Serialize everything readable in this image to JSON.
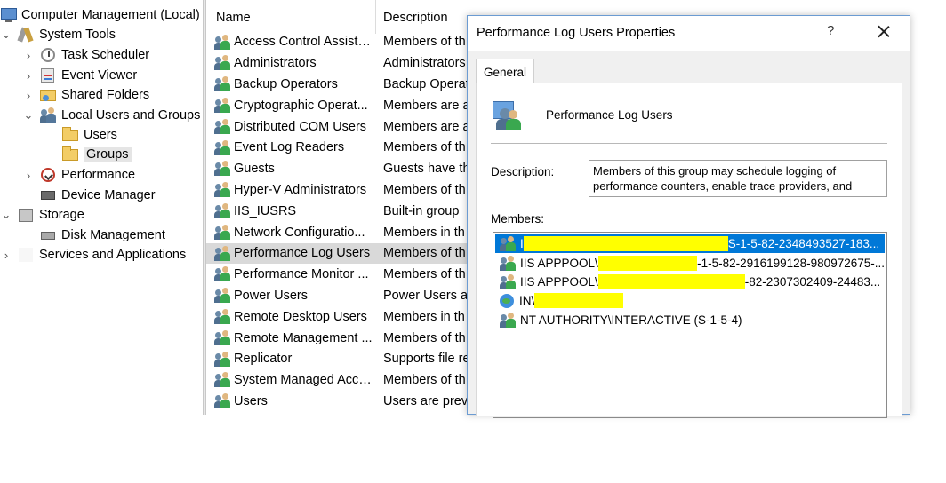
{
  "tree": {
    "items": [
      {
        "label": "Computer Management (Local)"
      },
      {
        "label": "System Tools"
      },
      {
        "label": "Task Scheduler"
      },
      {
        "label": "Event Viewer"
      },
      {
        "label": "Shared Folders"
      },
      {
        "label": "Local Users and Groups"
      },
      {
        "label": "Users"
      },
      {
        "label": "Groups"
      },
      {
        "label": "Performance"
      },
      {
        "label": "Device Manager"
      },
      {
        "label": "Storage"
      },
      {
        "label": "Disk Management"
      },
      {
        "label": "Services and Applications"
      }
    ]
  },
  "list": {
    "columns": [
      "Name",
      "Description"
    ],
    "rows": [
      {
        "name": "Access Control Assista...",
        "desc": "Members of th"
      },
      {
        "name": "Administrators",
        "desc": "Administrators"
      },
      {
        "name": "Backup Operators",
        "desc": "Backup Operat"
      },
      {
        "name": "Cryptographic Operat...",
        "desc": "Members are a"
      },
      {
        "name": "Distributed COM Users",
        "desc": "Members are a"
      },
      {
        "name": "Event Log Readers",
        "desc": "Members of th"
      },
      {
        "name": "Guests",
        "desc": "Guests have th"
      },
      {
        "name": "Hyper-V Administrators",
        "desc": "Members of th"
      },
      {
        "name": "IIS_IUSRS",
        "desc": "Built-in group"
      },
      {
        "name": "Network Configuratio...",
        "desc": "Members in th"
      },
      {
        "name": "Performance Log Users",
        "desc": "Members of th"
      },
      {
        "name": "Performance Monitor ...",
        "desc": "Members of th"
      },
      {
        "name": "Power Users",
        "desc": "Power Users ar"
      },
      {
        "name": "Remote Desktop Users",
        "desc": "Members in th"
      },
      {
        "name": "Remote Management ...",
        "desc": "Members of th"
      },
      {
        "name": "Replicator",
        "desc": "Supports file re"
      },
      {
        "name": "System Managed Acco...",
        "desc": "Members of th"
      },
      {
        "name": "Users",
        "desc": "Users are preve"
      }
    ]
  },
  "dialog": {
    "title": "Performance Log Users Properties",
    "help": "?",
    "tab": "General",
    "group_name": "Performance Log Users",
    "description_label": "Description:",
    "description_value": "Members of this group may schedule logging of performance counters, enable trace providers, and",
    "members_label": "Members:",
    "members": [
      {
        "pre": "I",
        "post": "S-1-5-82-2348493527-183..."
      },
      {
        "pre": "IIS APPPOOL\\",
        "post": "-1-5-82-2916199128-980972675-..."
      },
      {
        "pre": "IIS APPPOOL\\",
        "post": "-82-2307302409-24483..."
      },
      {
        "pre": "IN\\",
        "post": ""
      },
      {
        "pre": "NT AUTHORITY\\INTERACTIVE (S-1-5-4)",
        "post": ""
      }
    ]
  },
  "colors": {
    "selection_blue": "#0078d7",
    "redaction_yellow": "#ffff00",
    "selected_row": "#d9d9d9"
  }
}
